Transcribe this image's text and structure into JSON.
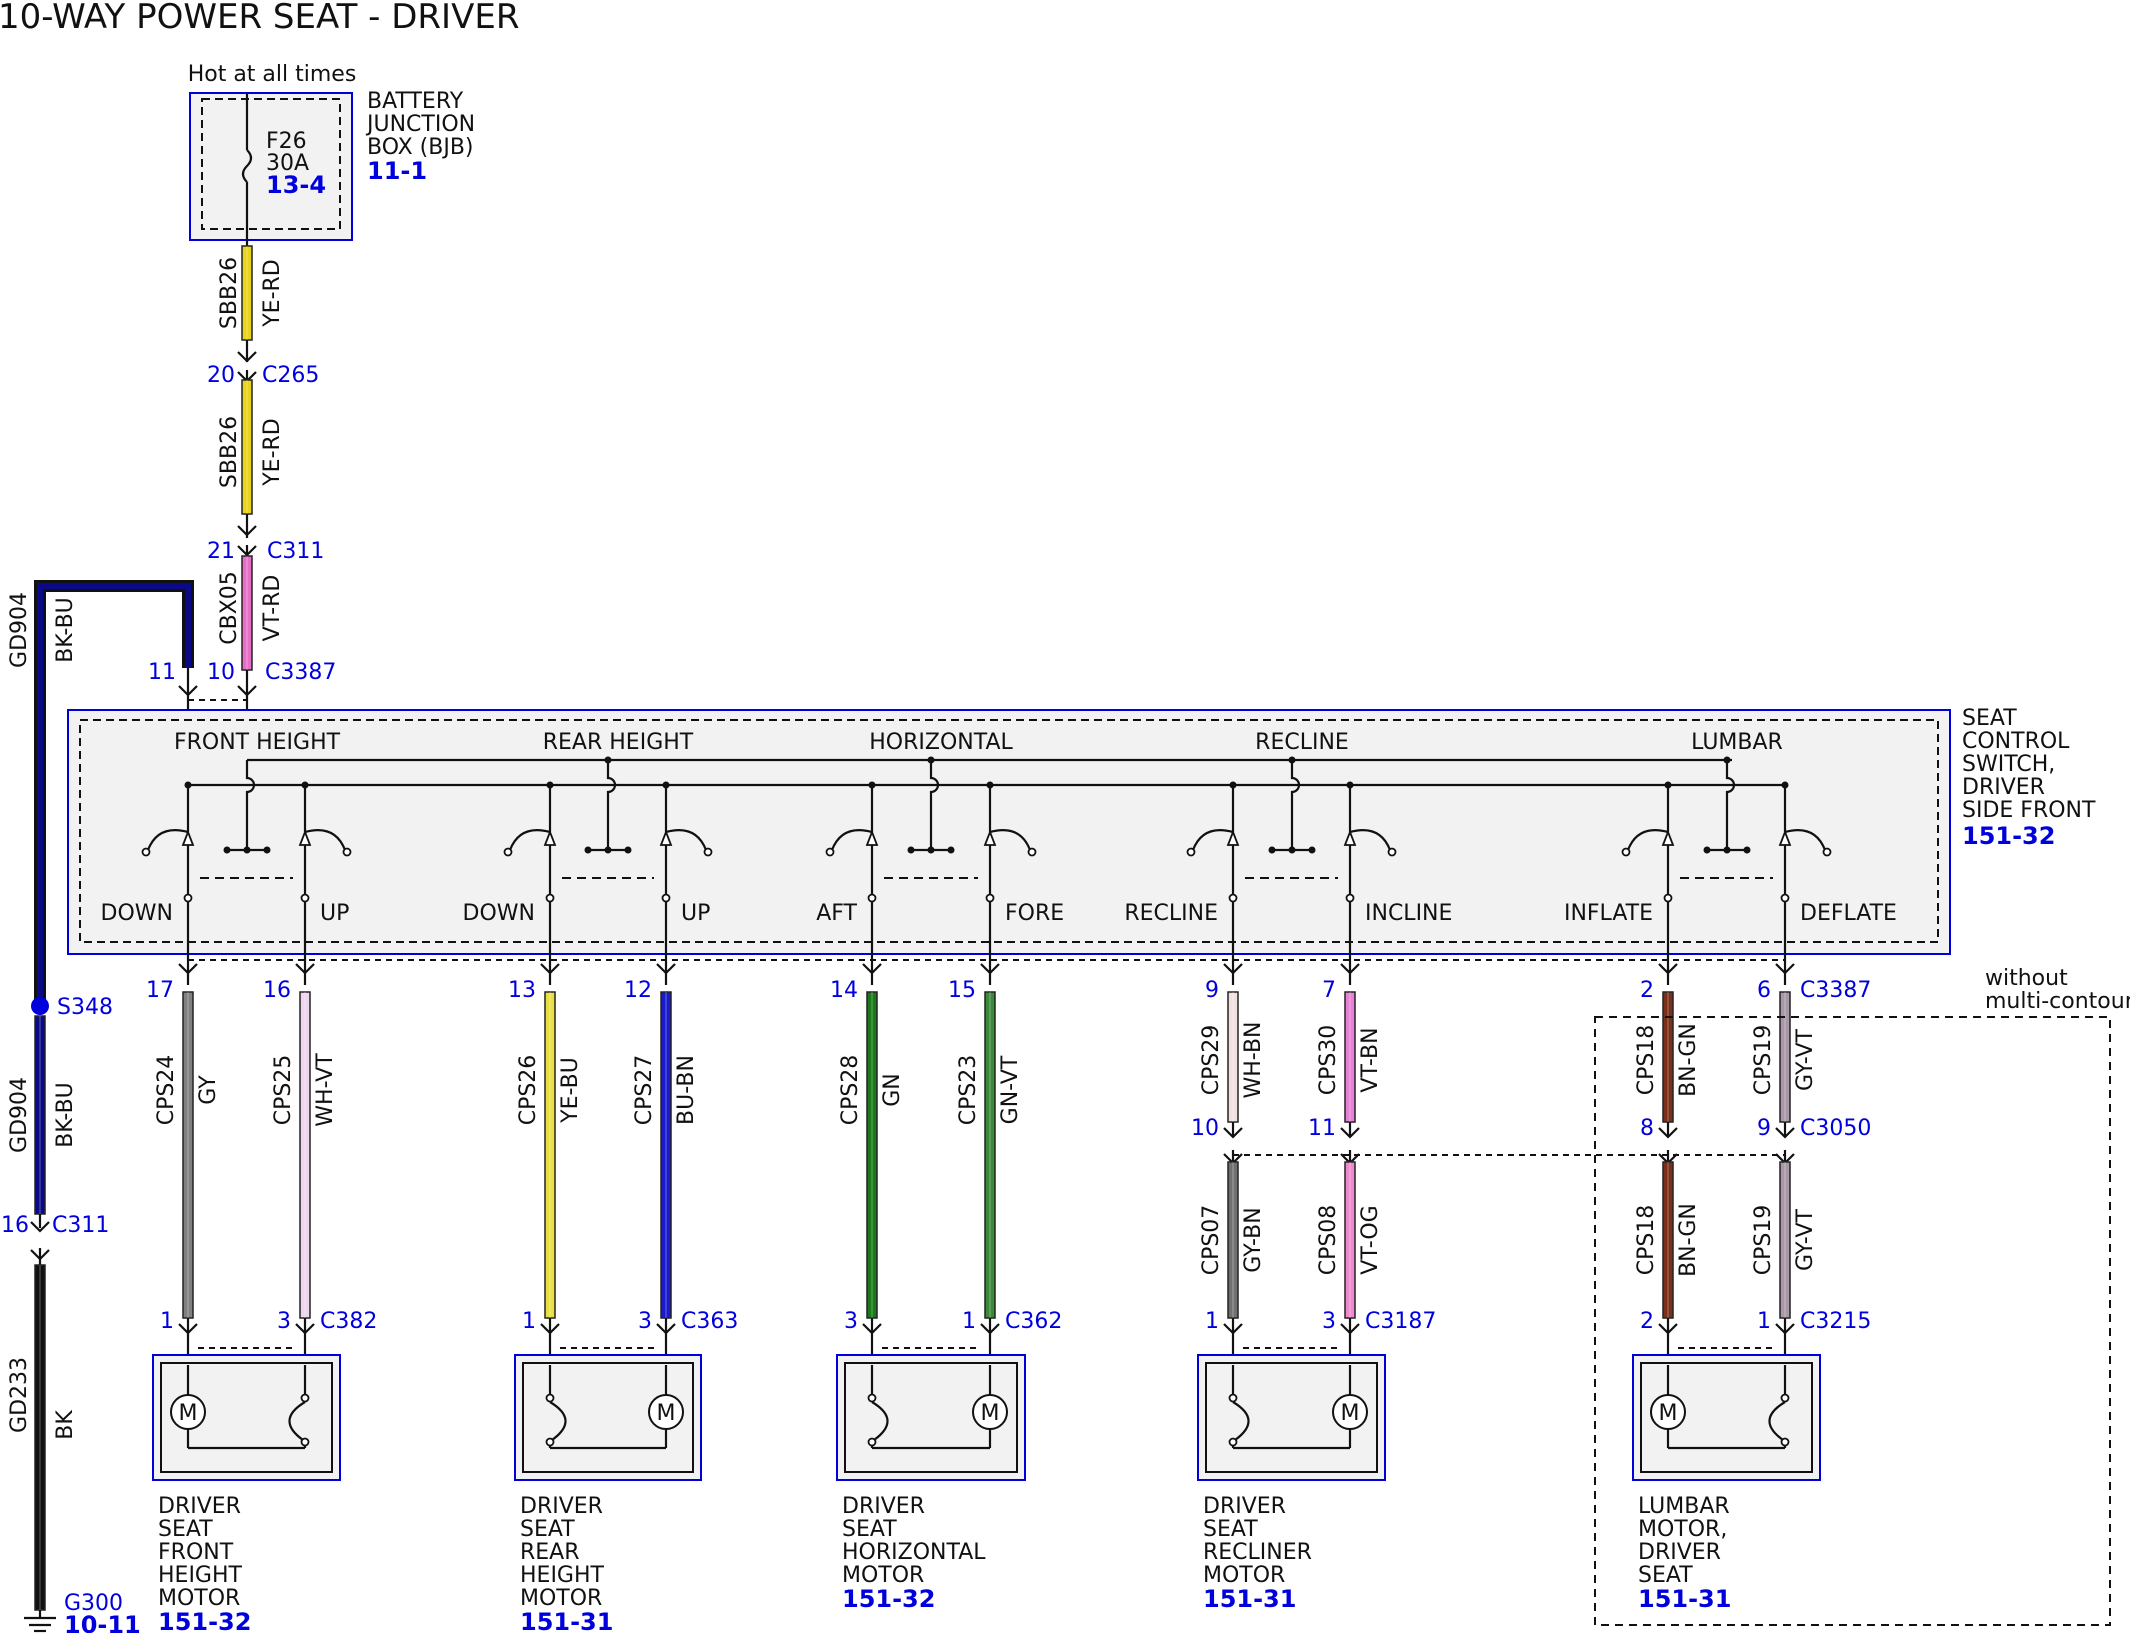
{
  "title": "10-WAY POWER SEAT - DRIVER",
  "colors": {
    "YE-RD": "#e8d41a",
    "VT-RD": "#e86fc8",
    "BK-BU": "#0a0a88",
    "BK": "#111111",
    "GY": "#808080",
    "WH-VT": "#eed6ee",
    "YE-BU": "#e8e040",
    "BU-BN": "#1a1acc",
    "GN": "#1a7a1a",
    "GN-VT": "#3a8a3a",
    "WH-BN": "#f0e0e0",
    "VT-BN": "#e880d8",
    "GY-BN": "#707070",
    "VT-OG": "#f08ad0",
    "BN-GN": "#7a3018",
    "GY-VT": "#a898a8",
    "connector_blue": "#0000dd",
    "component_fill": "#f2f2f2"
  },
  "power": {
    "hot_label": "Hot at all times",
    "bjb": {
      "name_lines": [
        "BATTERY",
        "JUNCTION",
        "BOX (BJB)"
      ],
      "ref": "11-1"
    },
    "fuse": {
      "id": "F26",
      "rating": "30A",
      "ref": "13-4"
    },
    "wire1": {
      "circuit": "SBB26",
      "color": "YE-RD"
    },
    "c265": {
      "pin": "20",
      "name": "C265"
    },
    "wire2": {
      "circuit": "SBB26",
      "color": "YE-RD"
    },
    "c311": {
      "pin": "21",
      "name": "C311"
    },
    "wire3": {
      "circuit": "CBX05",
      "color": "VT-RD"
    },
    "c3387": {
      "pin": "10",
      "name": "C3387"
    }
  },
  "ground": {
    "pin_top": "11",
    "wire1": {
      "circuit": "GD904",
      "color": "BK-BU"
    },
    "splice": "S348",
    "wire2": {
      "circuit": "GD904",
      "color": "BK-BU"
    },
    "c311": {
      "pin": "16",
      "name": "C311"
    },
    "wire3": {
      "circuit": "GD233",
      "color": "BK"
    },
    "g300": {
      "name": "G300",
      "ref": "10-11"
    }
  },
  "switch": {
    "name_lines": [
      "SEAT",
      "CONTROL",
      "SWITCH,",
      "DRIVER",
      "SIDE FRONT"
    ],
    "ref": "151-32",
    "sections": [
      {
        "name": "FRONT HEIGHT",
        "left": "DOWN",
        "right": "UP"
      },
      {
        "name": "REAR HEIGHT",
        "left": "DOWN",
        "right": "UP"
      },
      {
        "name": "HORIZONTAL",
        "left": "AFT",
        "right": "FORE"
      },
      {
        "name": "RECLINE",
        "left": "RECLINE",
        "right": "INCLINE"
      },
      {
        "name": "LUMBAR",
        "left": "INFLATE",
        "right": "DEFLATE"
      }
    ]
  },
  "outputs": [
    {
      "pin": "17",
      "circuit": "CPS24",
      "color": "GY"
    },
    {
      "pin": "16",
      "circuit": "CPS25",
      "color": "WH-VT"
    },
    {
      "pin": "13",
      "circuit": "CPS26",
      "color": "YE-BU"
    },
    {
      "pin": "12",
      "circuit": "CPS27",
      "color": "BU-BN"
    },
    {
      "pin": "14",
      "circuit": "CPS28",
      "color": "GN"
    },
    {
      "pin": "15",
      "circuit": "CPS23",
      "color": "GN-VT"
    },
    {
      "pin": "9",
      "circuit": "CPS29",
      "color": "WH-BN",
      "inline_pin": "10",
      "lower_circuit": "CPS07",
      "lower_color": "GY-BN"
    },
    {
      "pin": "7",
      "circuit": "CPS30",
      "color": "VT-BN",
      "inline_pin": "11",
      "lower_circuit": "CPS08",
      "lower_color": "VT-OG"
    },
    {
      "pin": "2",
      "circuit": "CPS18",
      "color": "BN-GN",
      "inline_pin": "8",
      "lower_circuit": "CPS18",
      "lower_color": "BN-GN"
    },
    {
      "pin": "6",
      "circuit": "CPS19",
      "color": "GY-VT",
      "connector": "C3387",
      "inline_pin": "9",
      "inline_connector": "C3050",
      "lower_circuit": "CPS19",
      "lower_color": "GY-VT"
    }
  ],
  "inline_connector_label": "C3050",
  "option_label_lines": [
    "without",
    "multi-contour"
  ],
  "motors": [
    {
      "pins": [
        "1",
        "3"
      ],
      "connector": "C382",
      "name_lines": [
        "DRIVER",
        "SEAT",
        "FRONT",
        "HEIGHT",
        "MOTOR"
      ],
      "ref": "151-32"
    },
    {
      "pins": [
        "1",
        "3"
      ],
      "connector": "C363",
      "name_lines": [
        "DRIVER",
        "SEAT",
        "REAR",
        "HEIGHT",
        "MOTOR"
      ],
      "ref": "151-31"
    },
    {
      "pins": [
        "3",
        "1"
      ],
      "connector": "C362",
      "name_lines": [
        "DRIVER",
        "SEAT",
        "HORIZONTAL",
        "MOTOR"
      ],
      "ref": "151-32"
    },
    {
      "pins": [
        "1",
        "3"
      ],
      "connector": "C3187",
      "name_lines": [
        "DRIVER",
        "SEAT",
        "RECLINER",
        "MOTOR"
      ],
      "ref": "151-31"
    },
    {
      "pins": [
        "2",
        "1"
      ],
      "connector": "C3215",
      "name_lines": [
        "LUMBAR",
        "MOTOR,",
        "DRIVER",
        "SEAT"
      ],
      "ref": "151-31"
    }
  ],
  "motor_symbol": "M"
}
